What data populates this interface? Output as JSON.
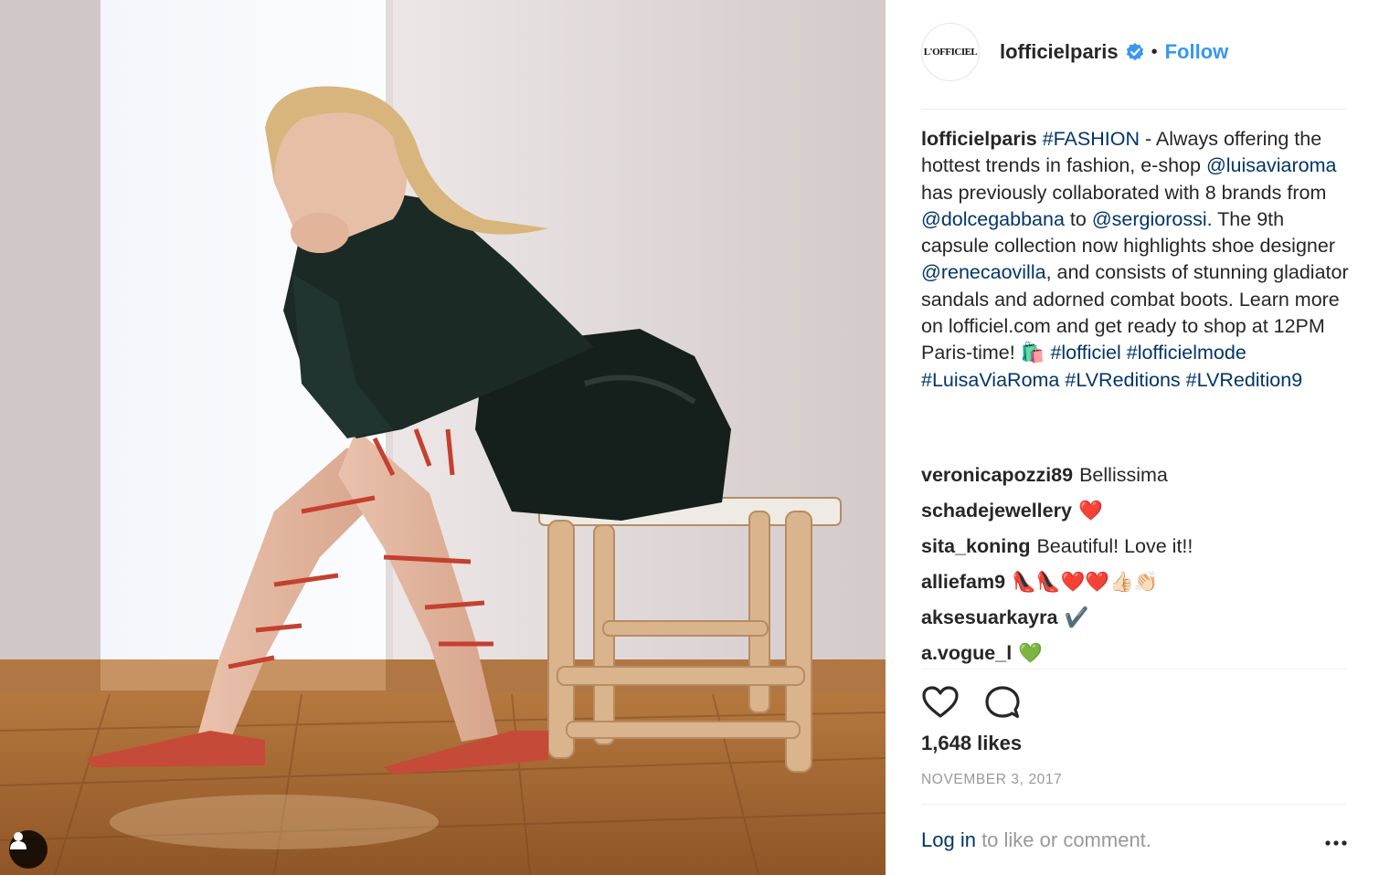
{
  "post": {
    "photo_alt": "",
    "header": {
      "avatar_text": "L'OFFICIEL",
      "username": "lofficielparis",
      "dot": "•",
      "follow_label": "Follow"
    },
    "caption": {
      "username": "lofficielparis",
      "parts": [
        {
          "text": "#FASHION",
          "link": true
        },
        {
          "text": " - Always offering the hottest trends in fashion, e-shop ",
          "link": false
        },
        {
          "text": "@luisaviaroma",
          "link": true
        },
        {
          "text": " has previously collaborated with 8 brands from ",
          "link": false
        },
        {
          "text": "@dolcegabbana",
          "link": true
        },
        {
          "text": " to ",
          "link": false
        },
        {
          "text": "@sergiorossi",
          "link": true
        },
        {
          "text": ". The 9th capsule collection now highlights shoe designer ",
          "link": false
        },
        {
          "text": "@renecaovilla",
          "link": true
        },
        {
          "text": ", and consists of stunning gladiator sandals and adorned combat boots. Learn more on lofficiel.com and get ready to shop at 12PM Paris-time! 🛍️ ",
          "link": false
        },
        {
          "text": "#lofficiel",
          "link": true
        },
        {
          "text": " ",
          "link": false
        },
        {
          "text": "#lofficielmode",
          "link": true
        },
        {
          "text": " ",
          "link": false
        },
        {
          "text": "#LuisaViaRoma",
          "link": true
        },
        {
          "text": " ",
          "link": false
        },
        {
          "text": "#LVReditions",
          "link": true
        },
        {
          "text": " ",
          "link": false
        },
        {
          "text": "#LVRedition9",
          "link": true
        }
      ]
    },
    "comments": [
      {
        "username": "veronicapozzi89",
        "text": "Bellissima"
      },
      {
        "username": "schadejewellery",
        "text": "❤️"
      },
      {
        "username": "sita_koning",
        "text": "Beautiful! Love it!!"
      },
      {
        "username": "alliefam9",
        "text": "👠👠❤️❤️👍🏻👏🏻"
      },
      {
        "username": "aksesuarkayra",
        "text": "✔️"
      },
      {
        "username": "a.vogue_l",
        "text": "💚"
      }
    ],
    "likes": "1,648 likes",
    "date": "NOVEMBER 3, 2017",
    "login": {
      "link_label": "Log in",
      "rest": " to like or comment."
    },
    "colors": {
      "accent": "#3897f0",
      "link": "#003569",
      "muted": "#999999",
      "text": "#262626"
    },
    "icons": [
      "heart-icon",
      "comment-icon",
      "verified-badge-icon",
      "more-options-icon",
      "user-tag-icon"
    ]
  }
}
